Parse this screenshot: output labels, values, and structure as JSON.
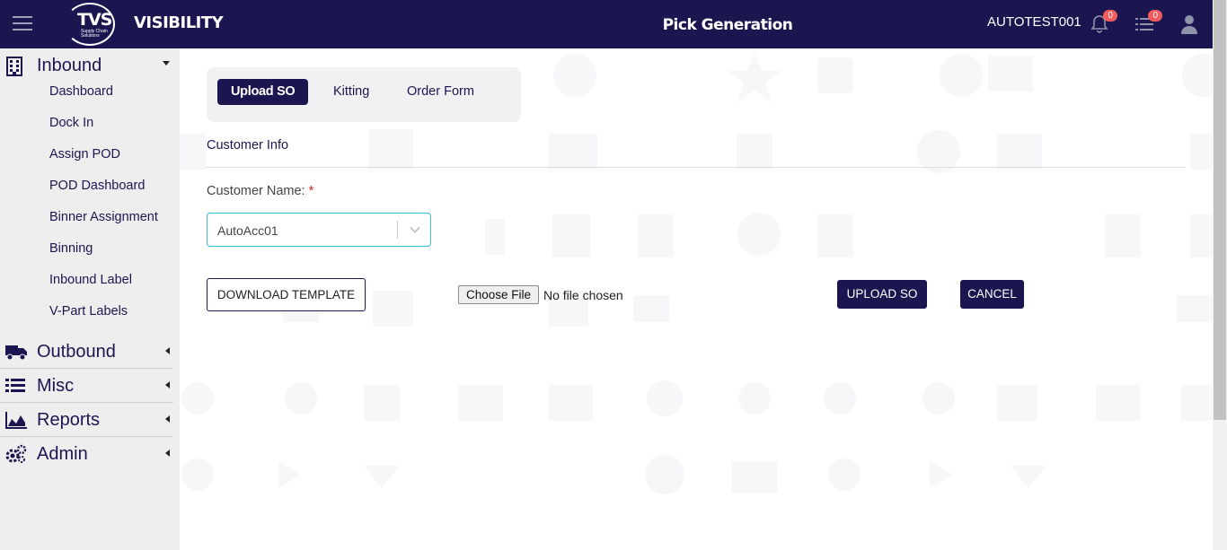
{
  "app": {
    "logo_text": "TVS",
    "logo_subtext": "Supply Chain Solutions",
    "brand": "VISIBILITY",
    "page_title": "Pick Generation",
    "username": "AUTOTEST001",
    "notifications_count": "0",
    "tasks_count": "0"
  },
  "sidebar": {
    "inbound": {
      "label": "Inbound",
      "items": [
        "Dashboard",
        "Dock In",
        "Assign POD",
        "POD Dashboard",
        "Binner Assignment",
        "Binning",
        "Inbound Label",
        "V-Part Labels"
      ]
    },
    "outbound_label": "Outbound",
    "misc_label": "Misc",
    "reports_label": "Reports",
    "admin_label": "Admin"
  },
  "tabs": [
    "Upload SO",
    "Kitting",
    "Order Form"
  ],
  "form": {
    "section_title": "Customer Info",
    "customer_label": "Customer Name:",
    "required_mark": "*",
    "customer_value": "AutoAcc01",
    "download_label": "DOWNLOAD TEMPLATE",
    "file_button": "Choose File",
    "file_status": "No file chosen",
    "upload_label": "UPLOAD SO",
    "cancel_label": "CANCEL"
  },
  "colors": {
    "primary": "#1c1650",
    "badge": "#f05b5b",
    "select_border": "#36c0d8",
    "required": "#e02424"
  }
}
